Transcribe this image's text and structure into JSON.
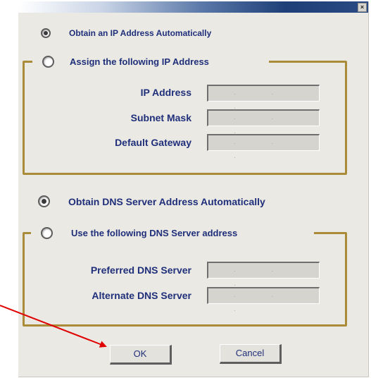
{
  "window": {
    "close_glyph": "×"
  },
  "ip_section": {
    "auto_option": {
      "label": "Obtain an IP Address Automatically",
      "selected": true
    },
    "manual_option": {
      "label": "Assign the following IP Address",
      "selected": false
    },
    "fields": [
      {
        "label": "IP Address",
        "value": ". . ."
      },
      {
        "label": "Subnet Mask",
        "value": ". . ."
      },
      {
        "label": "Default Gateway",
        "value": ". . ."
      }
    ]
  },
  "dns_section": {
    "auto_option": {
      "label": "Obtain DNS Server Address Automatically",
      "selected": true
    },
    "manual_option": {
      "label": "Use the following DNS Server address",
      "selected": false
    },
    "fields": [
      {
        "label": "Preferred DNS Server",
        "value": ". . ."
      },
      {
        "label": "Alternate DNS Server",
        "value": ". . ."
      }
    ]
  },
  "buttons": {
    "ok": "OK",
    "cancel": "Cancel"
  },
  "annotation": {
    "arrow_color": "#e00000",
    "points_to": "OK"
  },
  "colors": {
    "label_text": "#1f2f7a",
    "group_border": "#a98b3a",
    "dialog_bg": "#ebe9e4"
  }
}
